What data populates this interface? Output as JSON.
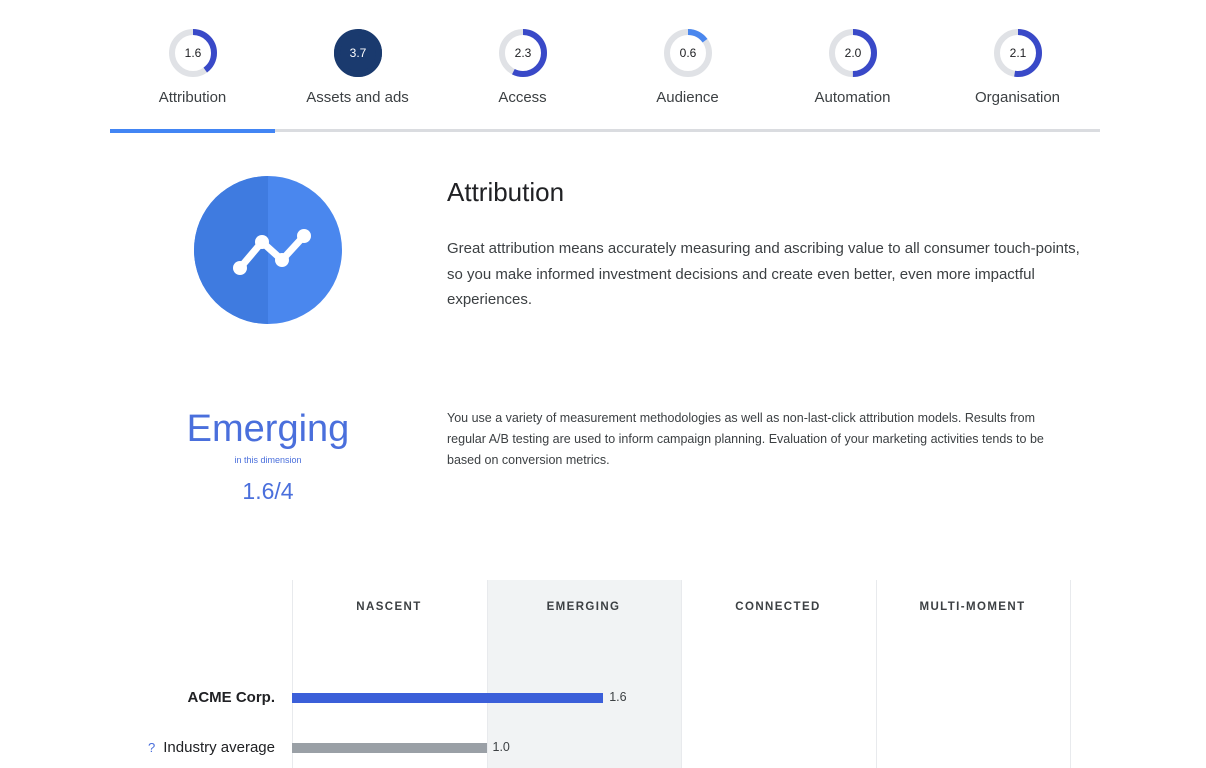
{
  "tabs": [
    {
      "label": "Attribution",
      "value": "1.6",
      "score": 1.6,
      "dark": false
    },
    {
      "label": "Assets and ads",
      "value": "3.7",
      "score": 3.7,
      "dark": true
    },
    {
      "label": "Access",
      "value": "2.3",
      "score": 2.3,
      "dark": false
    },
    {
      "label": "Audience",
      "value": "0.6",
      "score": 0.6,
      "dark": false
    },
    {
      "label": "Automation",
      "value": "2.0",
      "score": 2.0,
      "dark": false
    },
    {
      "label": "Organisation",
      "value": "2.1",
      "score": 2.1,
      "dark": false
    }
  ],
  "active_tab": 0,
  "score_max": 4,
  "hero": {
    "icon": "trend-line-icon",
    "title": "Attribution",
    "description": "Great attribution means accurately measuring and ascribing value to all consumer touch-points, so you make informed investment decisions and create even better, even more impactful experiences."
  },
  "stage": {
    "name": "Emerging",
    "subtitle": "in this dimension",
    "score_text": "1.6/4",
    "description": "You use a variety of measurement methodologies as well as non-last-click attribution models. Results from regular A/B testing are used to inform campaign planning. Evaluation of your marketing activities tends to be based on conversion metrics."
  },
  "colors": {
    "accent": "#4285f4",
    "gauge_track": "#e0e2e6",
    "gauge_fill": "#3949c8",
    "gauge_dark": "#1a3a6e",
    "company_bar": "#3b5fd9",
    "industry_bar": "#9aa0a6",
    "highlight_column": "#f1f3f4"
  },
  "chart_data": {
    "type": "bar",
    "orientation": "horizontal",
    "stages": [
      "NASCENT",
      "EMERGING",
      "CONNECTED",
      "MULTI-MOMENT"
    ],
    "highlighted_stage": "EMERGING",
    "xlim": [
      0,
      4
    ],
    "categories": [
      "ACME Corp.",
      "Industry average"
    ],
    "values": [
      1.6,
      1.0
    ],
    "value_labels": [
      "1.6",
      "1.0"
    ],
    "help_marker": "?"
  }
}
